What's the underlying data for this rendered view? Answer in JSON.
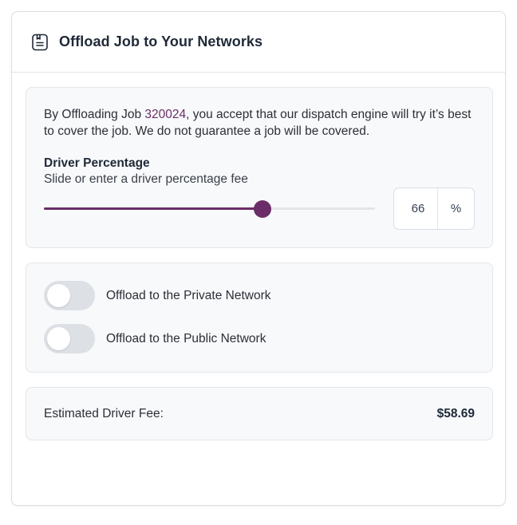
{
  "header": {
    "title": "Offload Job to Your Networks",
    "icon": "receipt-icon"
  },
  "offload": {
    "intro_before": "By Offloading Job ",
    "job_number": "320024",
    "intro_after": ", you accept that our dispatch engine will try it’s best to cover the job. We do not guarantee a job will be covered.",
    "driver_percentage_title": "Driver Percentage",
    "driver_percentage_subtitle": "Slide or enter a driver percentage fee",
    "slider_percent": 66,
    "percentage_value": "66",
    "percent_suffix": "%",
    "accent_color": "#6b2d67"
  },
  "toggles": [
    {
      "label": "Offload to the Private Network",
      "on": false
    },
    {
      "label": "Offload to the Public Network",
      "on": false
    }
  ],
  "fee": {
    "label": "Estimated Driver Fee:",
    "value": "$58.69"
  }
}
